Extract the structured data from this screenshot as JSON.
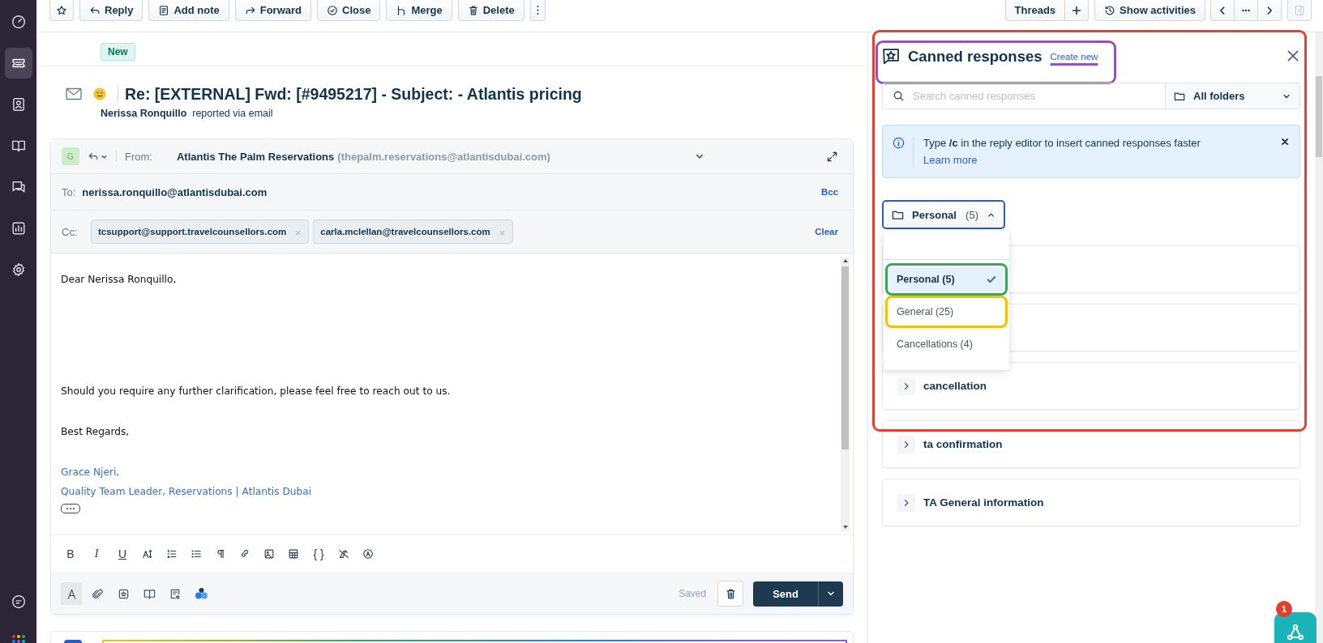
{
  "nav": [
    {
      "kind": "dashboard",
      "selected": false
    },
    {
      "kind": "tickets",
      "selected": true
    },
    {
      "kind": "contacts",
      "selected": false
    },
    {
      "kind": "knowledge",
      "selected": false
    },
    {
      "kind": "chat",
      "selected": false
    },
    {
      "kind": "reports",
      "selected": false
    },
    {
      "kind": "settings",
      "selected": false
    }
  ],
  "nav_bottom": [
    {
      "kind": "feedback"
    },
    {
      "kind": "apps"
    }
  ],
  "toolbar": {
    "left": [
      {
        "kind": "star"
      },
      {
        "kind": "reply",
        "label": "Reply"
      },
      {
        "kind": "note",
        "label": "Add note"
      },
      {
        "kind": "forward",
        "label": "Forward"
      },
      {
        "kind": "close",
        "label": "Close"
      },
      {
        "kind": "merge",
        "label": "Merge"
      },
      {
        "kind": "delete",
        "label": "Delete"
      },
      {
        "kind": "more"
      }
    ],
    "right": [
      {
        "kind": "text",
        "label": "Threads"
      },
      {
        "kind": "plus"
      },
      {
        "kind": "activities",
        "label": "Show activities"
      },
      {
        "kind": "prev"
      },
      {
        "kind": "dots"
      },
      {
        "kind": "next"
      },
      {
        "kind": "panel",
        "disabled": true
      }
    ]
  },
  "ticket": {
    "status": "New",
    "subject": "Re: [EXTERNAL] Fwd: [#9495217] - Subject: - Atlantis pricing",
    "reporter": "Nerissa Ronquillo",
    "via": "reported via email"
  },
  "reply": {
    "avatar": "G",
    "from_label": "From:",
    "from_name": "Atlantis The Palm Reservations",
    "from_email": "(thepalm.reservations@atlantisdubai.com)",
    "to_label": "To:",
    "to": "nerissa.ronquillo@atlantisdubai.com",
    "bcc": "Bcc",
    "cc_label": "Cc:",
    "cc": [
      "tcsupport@support.travelcounsellors.com",
      "carla.mclellan@travelcounsellors.com"
    ],
    "clear": "Clear",
    "body": [
      {
        "kind": "text",
        "text": "Dear  Nerissa Ronquillo,"
      },
      {
        "kind": "text",
        "text": "Should you require any further clarification, please feel free to reach out to us."
      },
      {
        "kind": "text",
        "text": "Best Regards,"
      },
      {
        "kind": "signature",
        "text": "Grace Njeri,"
      },
      {
        "kind": "signature",
        "text": "Quality Team Leader, Reservations | Atlantis Dubai"
      }
    ],
    "format_tools": [
      {
        "kind": "bold",
        "glyph": "B"
      },
      {
        "kind": "italic",
        "glyph": "I"
      },
      {
        "kind": "underline",
        "glyph": "U"
      },
      {
        "kind": "size"
      },
      {
        "kind": "ol"
      },
      {
        "kind": "ul"
      },
      {
        "kind": "paragraph"
      },
      {
        "kind": "link"
      },
      {
        "kind": "image"
      },
      {
        "kind": "table"
      },
      {
        "kind": "code",
        "glyph": "{ }"
      },
      {
        "kind": "clear"
      },
      {
        "kind": "spell"
      }
    ],
    "bottom_tools": [
      {
        "kind": "textcolor",
        "selected": true
      },
      {
        "kind": "attach",
        "selected": false
      },
      {
        "kind": "canned",
        "selected": false
      },
      {
        "kind": "book",
        "selected": false
      },
      {
        "kind": "form",
        "selected": false
      },
      {
        "kind": "ai",
        "selected": false
      }
    ],
    "saved": "Saved",
    "send": "Send"
  },
  "panel": {
    "color": "#e2412f",
    "header": {
      "color": "#9456b4",
      "title": "Canned responses",
      "create_new": "Create new"
    },
    "search": {
      "placeholder": "Search canned responses"
    },
    "folder_filter": "All folders",
    "tip": {
      "text": "Type **/c** in the reply editor to insert canned responses faster",
      "link": "Learn more"
    },
    "folder_select": {
      "label": "Personal",
      "count": "(5)",
      "expanded": true
    },
    "folder_options": [
      {
        "label": "Personal (5)",
        "selected": true,
        "color": "#3aa757"
      },
      {
        "label": "General (25)",
        "selected": false,
        "color": "#f5c000"
      },
      {
        "label": "Cancellations (4)",
        "selected": false
      }
    ],
    "responses": [
      {
        "kind": "covered"
      },
      {
        "kind": "covered"
      },
      {
        "kind": "folder",
        "title": "cancellation"
      },
      {
        "kind": "folder",
        "title": "ta confirmation"
      },
      {
        "kind": "folder",
        "title": "TA General information"
      }
    ]
  },
  "help": {
    "badge": "1"
  }
}
